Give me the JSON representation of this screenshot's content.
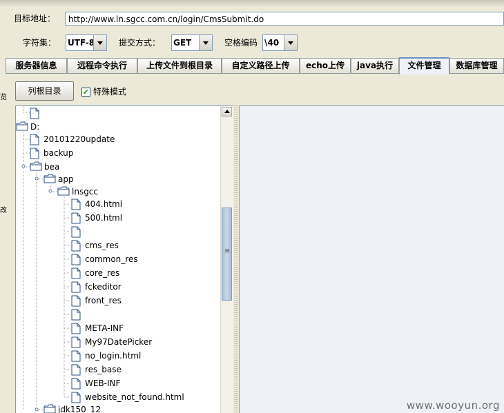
{
  "form": {
    "target_label": "目标地址：",
    "target_value": "http://www.ln.sgcc.com.cn/login/CmsSubmit.do",
    "charset_label": "字符集：",
    "charset_value": "UTF-8",
    "method_label": "提交方式：",
    "method_value": "GET",
    "space_label": "空格编码",
    "space_value": "\\40"
  },
  "tabs": [
    {
      "label": "服务器信息"
    },
    {
      "label": "远程命令执行"
    },
    {
      "label": "上传文件到根目录"
    },
    {
      "label": "自定义路径上传"
    },
    {
      "label": "echo上传"
    },
    {
      "label": "java执行"
    },
    {
      "label": "文件管理",
      "active": true
    },
    {
      "label": "数据库管理"
    }
  ],
  "toolbar": {
    "list_root_label": "列根目录",
    "special_mode_label": "特殊模式",
    "special_mode_checked": true
  },
  "tree": [
    {
      "label": "",
      "type": "file"
    },
    {
      "label": "D:",
      "type": "folder"
    },
    {
      "label": "20101220update",
      "type": "file"
    },
    {
      "label": "backup",
      "type": "file"
    },
    {
      "label": "bea",
      "type": "folder"
    },
    {
      "label": "app",
      "type": "folder"
    },
    {
      "label": "lnsgcc",
      "type": "folder"
    },
    {
      "label": "404.html",
      "type": "file"
    },
    {
      "label": "500.html",
      "type": "file"
    },
    {
      "label": "",
      "type": "file"
    },
    {
      "label": "cms_res",
      "type": "file"
    },
    {
      "label": "common_res",
      "type": "file"
    },
    {
      "label": "core_res",
      "type": "file"
    },
    {
      "label": "fckeditor",
      "type": "file"
    },
    {
      "label": "front_res",
      "type": "file"
    },
    {
      "label": "",
      "type": "file"
    },
    {
      "label": "META-INF",
      "type": "file"
    },
    {
      "label": "My97DatePicker",
      "type": "file"
    },
    {
      "label": "no_login.html",
      "type": "file"
    },
    {
      "label": "res_base",
      "type": "file"
    },
    {
      "label": "WEB-INF",
      "type": "file"
    },
    {
      "label": "website_not_found.html",
      "type": "file"
    },
    {
      "label": "jdk150_12",
      "type": "folder"
    }
  ],
  "watermark": "www.wooyun.org",
  "edge_glyphs": [
    "览",
    "改"
  ]
}
